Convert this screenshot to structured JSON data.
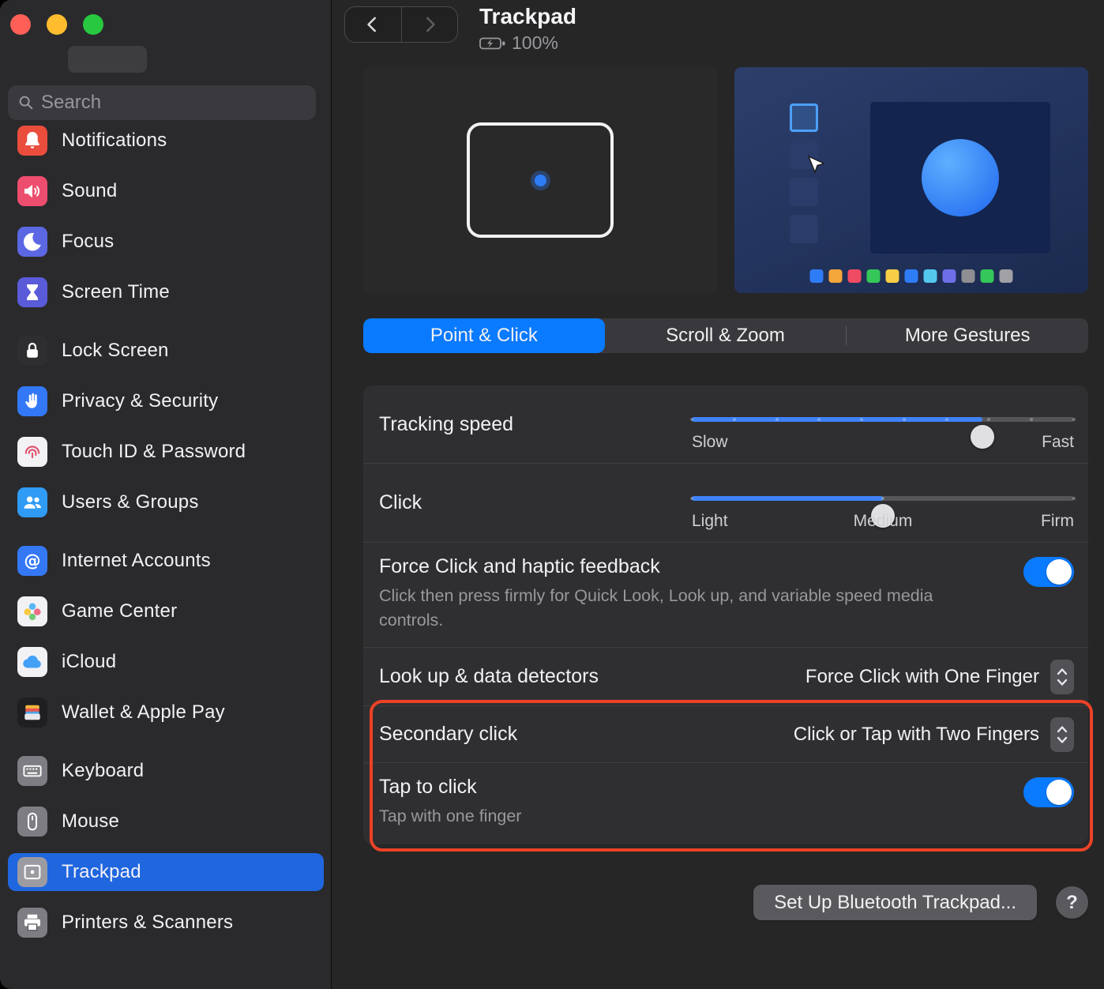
{
  "colors": {
    "accent": "#0a7aff",
    "slider_fill": "#3f82f7",
    "annotation": "#ec4226",
    "sidebar_selected": "#2066df"
  },
  "sidebar": {
    "search": {
      "placeholder": "Search"
    },
    "groups": [
      {
        "items": [
          {
            "label": "Notifications",
            "icon": "bell",
            "color": "#eb4d3d"
          },
          {
            "label": "Sound",
            "icon": "speaker",
            "color": "#ed4d6e"
          },
          {
            "label": "Focus",
            "icon": "moon",
            "color": "#5b67e3"
          },
          {
            "label": "Screen Time",
            "icon": "hourglass",
            "color": "#5a5bd8"
          }
        ]
      },
      {
        "items": [
          {
            "label": "Lock Screen",
            "icon": "lock",
            "color": "#2e2e31"
          },
          {
            "label": "Privacy & Security",
            "icon": "hand",
            "color": "#3378f6"
          },
          {
            "label": "Touch ID & Password",
            "icon": "fingerprint",
            "color": "#f2f2f5"
          },
          {
            "label": "Users & Groups",
            "icon": "users",
            "color": "#2f9bf5"
          }
        ]
      },
      {
        "items": [
          {
            "label": "Internet Accounts",
            "icon": "at",
            "color": "#3478f6"
          },
          {
            "label": "Game Center",
            "icon": "gamecenter",
            "color": "#f2f2f5"
          },
          {
            "label": "iCloud",
            "icon": "cloud",
            "color": "#f2f2f5"
          },
          {
            "label": "Wallet & Apple Pay",
            "icon": "wallet",
            "color": "#1f1f22"
          }
        ]
      },
      {
        "items": [
          {
            "label": "Keyboard",
            "icon": "keyboard",
            "color": "#7d7d83"
          },
          {
            "label": "Mouse",
            "icon": "mouse",
            "color": "#7d7d83"
          },
          {
            "label": "Trackpad",
            "icon": "trackpad",
            "color": "#9b9ba1",
            "selected": true
          },
          {
            "label": "Printers & Scanners",
            "icon": "printer",
            "color": "#7d7d83"
          }
        ]
      }
    ]
  },
  "header": {
    "title": "Trackpad",
    "battery": "100%"
  },
  "tabs": [
    {
      "label": "Point & Click",
      "active": true
    },
    {
      "label": "Scroll & Zoom",
      "active": false
    },
    {
      "label": "More Gestures",
      "active": false
    }
  ],
  "preview": {
    "dock_colors": [
      "#2e7cf6",
      "#f5a63b",
      "#ef4b63",
      "#35c759",
      "#f7ce45",
      "#2e7cf6",
      "#54c7ec",
      "#6e6ee8",
      "#8e8e93",
      "#35c759",
      "#a0a0a5"
    ]
  },
  "settings": {
    "tracking_speed": {
      "label": "Tracking speed",
      "min_label": "Slow",
      "max_label": "Fast",
      "value_pct": 76,
      "ticks": 10
    },
    "click": {
      "label": "Click",
      "min_label": "Light",
      "mid_label": "Medium",
      "max_label": "Firm",
      "value_pct": 50,
      "ticks": 3
    },
    "force_click": {
      "label": "Force Click and haptic feedback",
      "description": "Click then press firmly for Quick Look, Look up, and variable speed media controls.",
      "enabled": true
    },
    "look_up": {
      "label": "Look up & data detectors",
      "value": "Force Click with One Finger"
    },
    "secondary_click": {
      "label": "Secondary click",
      "value": "Click or Tap with Two Fingers"
    },
    "tap_to_click": {
      "label": "Tap to click",
      "description": "Tap with one finger",
      "enabled": true
    }
  },
  "footer": {
    "setup_button": "Set Up Bluetooth Trackpad...",
    "help_button": "?"
  }
}
